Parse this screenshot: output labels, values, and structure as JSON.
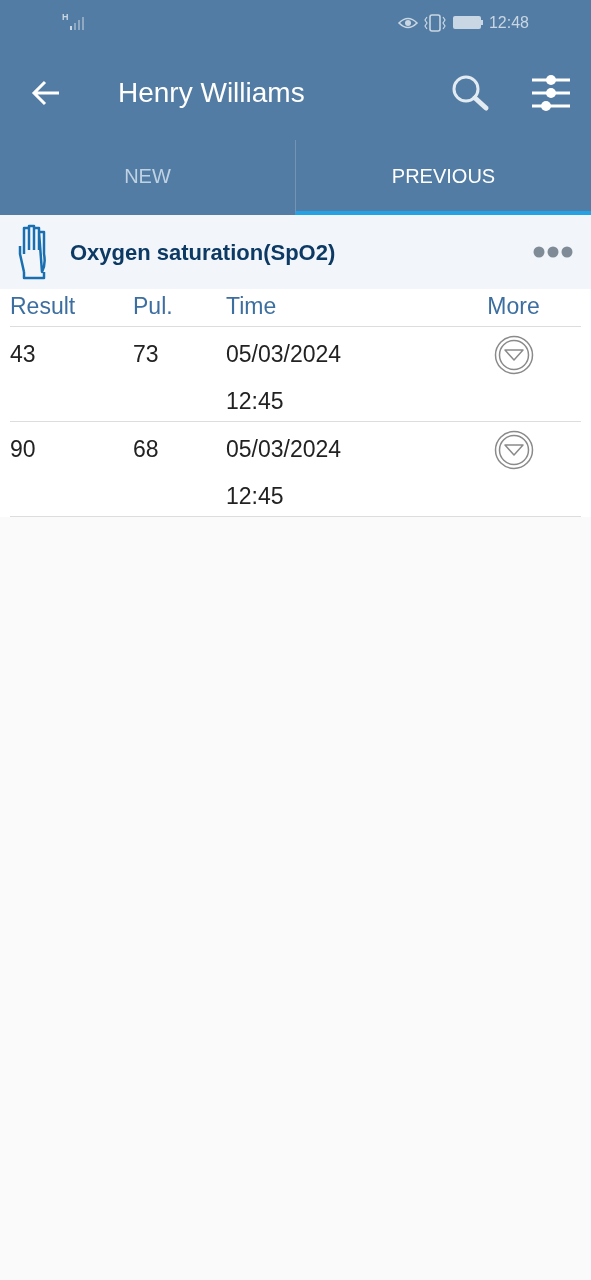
{
  "status_bar": {
    "network": "H",
    "time": "12:48"
  },
  "app_bar": {
    "title": "Henry Williams"
  },
  "tabs": [
    {
      "label": "NEW",
      "selected": false
    },
    {
      "label": "PREVIOUS",
      "selected": true
    }
  ],
  "section": {
    "title": "Oxygen saturation(SpO2)"
  },
  "table": {
    "columns": [
      "Result",
      "Pul.",
      "Time",
      "More"
    ],
    "rows": [
      {
        "result": "43",
        "pulse": "73",
        "time": "05/03/2024 12:45"
      },
      {
        "result": "90",
        "pulse": "68",
        "time": "05/03/2024 12:45"
      }
    ]
  }
}
